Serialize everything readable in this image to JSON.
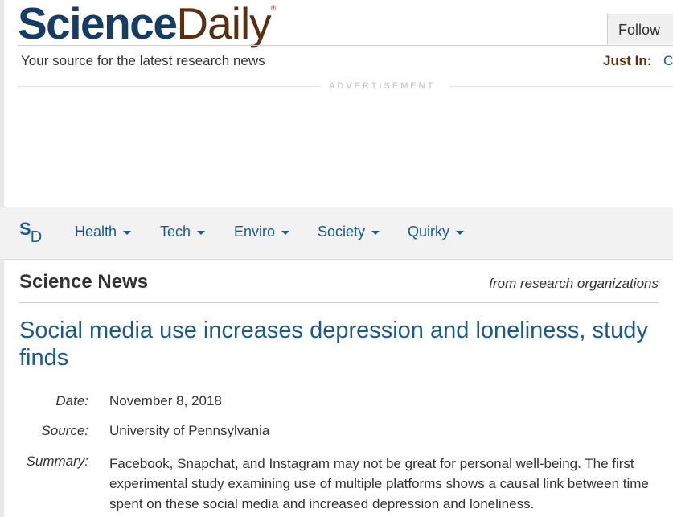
{
  "brand": {
    "science": "Science",
    "daily": "Daily",
    "registered": "®",
    "tagline": "Your source for the latest research news",
    "colors": {
      "navy": "#173c63",
      "brown": "#5a2f12",
      "link": "#1b5a8c"
    }
  },
  "header": {
    "follow_label": "Follow",
    "just_in_label": "Just In:",
    "just_in_item": "C"
  },
  "ad": {
    "label": "ADVERTISEMENT"
  },
  "nav": {
    "logo_s": "S",
    "logo_d": "D",
    "items": [
      {
        "label": "Health"
      },
      {
        "label": "Tech"
      },
      {
        "label": "Enviro"
      },
      {
        "label": "Society"
      },
      {
        "label": "Quirky"
      }
    ]
  },
  "section": {
    "title": "Science News",
    "subtitle": "from research organizations"
  },
  "article": {
    "headline": "Social media use increases depression and loneliness, study finds",
    "date_label": "Date:",
    "date": "November 8, 2018",
    "source_label": "Source:",
    "source": "University of Pennsylvania",
    "summary_label": "Summary:",
    "summary": "Facebook, Snapchat, and Instagram may not be great for personal well-being. The first experimental study examining use of multiple platforms shows a causal link between time spent on these social media and increased depression and loneliness."
  }
}
